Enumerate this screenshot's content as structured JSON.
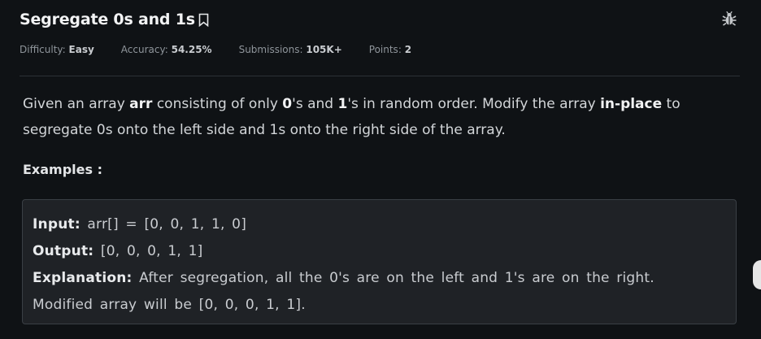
{
  "problem": {
    "title": "Segregate 0s and 1s",
    "meta": {
      "difficulty_label": "Difficulty:",
      "difficulty_value": "Easy",
      "accuracy_label": "Accuracy:",
      "accuracy_value": "54.25%",
      "submissions_label": "Submissions:",
      "submissions_value": "105K+",
      "points_label": "Points:",
      "points_value": "2"
    },
    "description": {
      "p1": "Given an array ",
      "p2": "arr",
      "p3": " consisting of only ",
      "p4": "0",
      "p5": "'s and ",
      "p6": "1",
      "p7": "'s in random order. Modify the array ",
      "p8": "in-place",
      "p9": " to segregate 0s onto the left side and 1s onto the right side of the array."
    },
    "examples_heading": "Examples :",
    "example": {
      "input_label": "Input:",
      "input_value": " arr[] = [0, 0, 1, 1, 0]",
      "output_label": "Output:",
      "output_value": " [0, 0, 0, 1, 1]",
      "explanation_label": "Explanation:",
      "explanation_value": "  After segregation, all the 0's are on the left and 1's are on the right.",
      "explanation_line2": "Modified array will be [0, 0, 0, 1, 1]."
    }
  },
  "icons": {
    "bookmark": "bookmark-icon",
    "report": "bug-icon"
  },
  "colors": {
    "background": "#0f1215",
    "example_bg": "#1f2226",
    "border": "#3a3f45"
  }
}
